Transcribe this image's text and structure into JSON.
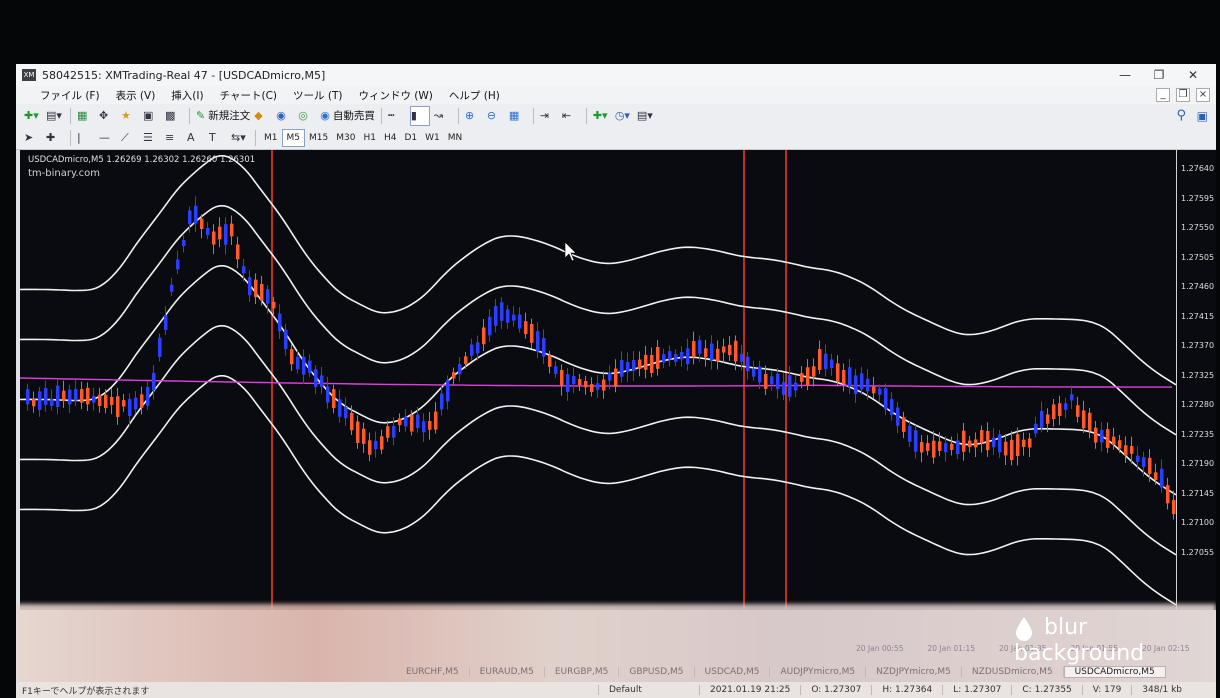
{
  "window": {
    "title": "58042515: XMTrading-Real 47 - [USDCADmicro,M5]",
    "app_icon_text": "XM"
  },
  "menu": [
    "ファイル (F)",
    "表示 (V)",
    "挿入(I)",
    "チャート(C)",
    "ツール (T)",
    "ウィンドウ (W)",
    "ヘルプ (H)"
  ],
  "toolbar": {
    "new_order_label": "新規注文",
    "auto_trading_label": "自動売買"
  },
  "timeframes": [
    "M1",
    "M5",
    "M15",
    "M30",
    "H1",
    "H4",
    "D1",
    "W1",
    "MN"
  ],
  "active_timeframe": "M5",
  "chart": {
    "symbol_label": "USDCADmicro,M5  1.26269 1.26302 1.26260 1.26301",
    "watermark": "tm-binary.com",
    "price_ticks": [
      "1.27640",
      "1.27595",
      "1.27550",
      "1.27505",
      "1.27460",
      "1.27415",
      "1.27370",
      "1.27325",
      "1.27280",
      "1.27235",
      "1.27190",
      "1.27145",
      "1.27100",
      "1.27055"
    ],
    "time_labels": [
      "20 Jan 00:55",
      "20 Jan 01:15",
      "20 Jan 01:35",
      "20 Jan 01:55",
      "20 Jan 02:15"
    ],
    "colors": {
      "bull": "#ff5a2e",
      "bear": "#2a3fff",
      "band": "#f2f2f2",
      "ma": "#e040e0",
      "vline": "#ff3b1f",
      "bg": "#0a0b10"
    }
  },
  "tabs": [
    "EURCHF,M5",
    "EURAUD,M5",
    "EURGBP,M5",
    "GBPUSD,M5",
    "USDCAD,M5",
    "AUDJPYmicro,M5",
    "NZDJPYmicro,M5",
    "NZDUSDmicro,M5",
    "USDCADmicro,M5"
  ],
  "active_tab": "USDCADmicro,M5",
  "status": {
    "help_text": "F1キーでヘルプが表示されます",
    "profile": "Default",
    "datetime": "2021.01.19 21:25",
    "open": "O: 1.27307",
    "high": "H: 1.27364",
    "low": "L: 1.27307",
    "close": "C: 1.27355",
    "volume": "V: 179",
    "traffic": "348/1 kb"
  },
  "watermark_overlay": {
    "line1": "blur",
    "line2": "background"
  }
}
